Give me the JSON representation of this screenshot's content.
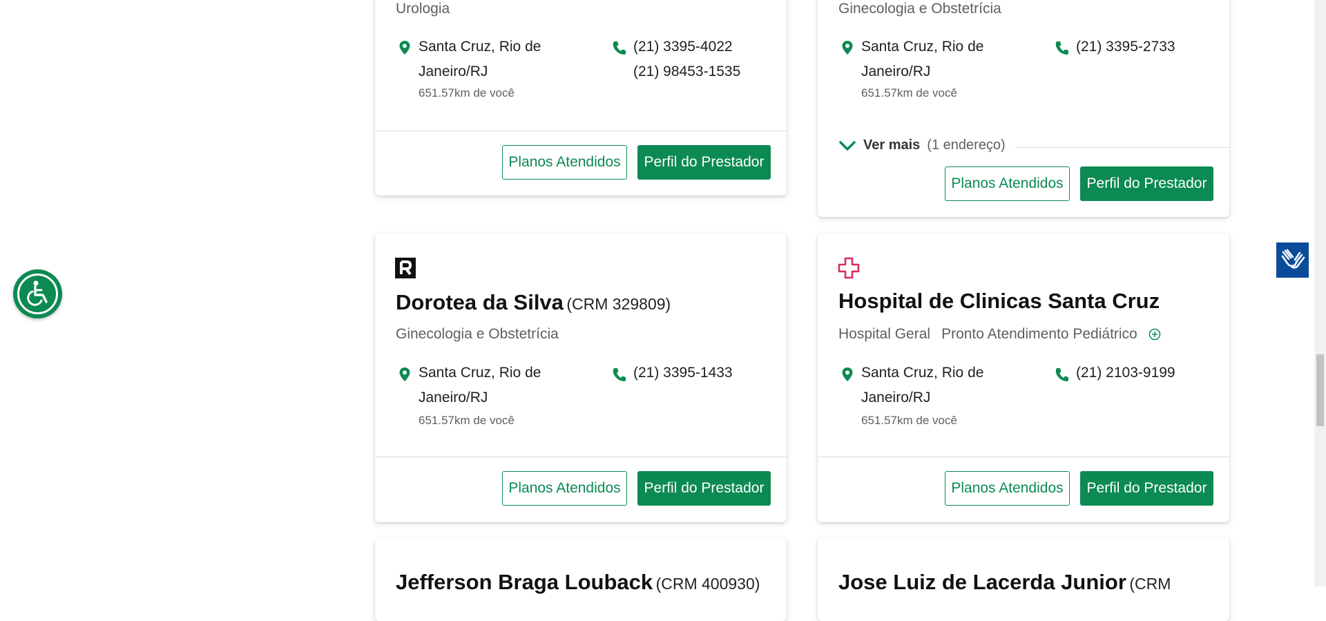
{
  "colors": {
    "brand_green": "#0b8a52",
    "accessibility_blue": "#0a4b9a",
    "cross_red": "#d72c5a"
  },
  "icons": {
    "location": "location-pin-icon",
    "phone": "phone-icon",
    "chevron": "chevron-down-icon",
    "plus": "plus-circle-icon",
    "accessibility": "wheelchair-accessibility-icon",
    "sign_language": "sign-language-hands-icon",
    "doctor_badge": "r-badge-icon",
    "hospital": "hospital-cross-icon"
  },
  "cards": {
    "urologia": {
      "specialty": "Urologia",
      "address_line1": "Santa Cruz, Rio de",
      "address_line2": "Janeiro/RJ",
      "distance": "651.57km de você",
      "phone1": "(21) 3395-4022",
      "phone2": "(21) 98453-1535",
      "plans_btn": "Planos Atendidos",
      "profile_btn": "Perfil do Prestador"
    },
    "gineco_top": {
      "specialty": "Ginecologia e Obstetrícia",
      "address_line1": "Santa Cruz, Rio de",
      "address_line2": "Janeiro/RJ",
      "distance": "651.57km de você",
      "phone1": "(21) 3395-2733",
      "ver_mais": "Ver mais",
      "ver_mais_count": "(1 endereço)",
      "plans_btn": "Planos Atendidos",
      "profile_btn": "Perfil do Prestador"
    },
    "dorotea": {
      "name": "Dorotea da Silva",
      "crm": "(CRM 329809)",
      "specialty": "Ginecologia e Obstetrícia",
      "address_line1": "Santa Cruz, Rio de",
      "address_line2": "Janeiro/RJ",
      "distance": "651.57km de você",
      "phone1": "(21) 3395-1433",
      "plans_btn": "Planos Atendidos",
      "profile_btn": "Perfil do Prestador"
    },
    "hospital": {
      "name": "Hospital de Clinicas Santa Cruz",
      "specialty1": "Hospital Geral",
      "specialty2": "Pronto Atendimento Pediátrico",
      "address_line1": "Santa Cruz, Rio de",
      "address_line2": "Janeiro/RJ",
      "distance": "651.57km de você",
      "phone1": "(21) 2103-9199",
      "plans_btn": "Planos Atendidos",
      "profile_btn": "Perfil do Prestador"
    },
    "jefferson": {
      "name": "Jefferson Braga Louback",
      "crm": "(CRM 400930)"
    },
    "jose": {
      "name": "Jose Luiz de Lacerda Junior",
      "crm": "(CRM"
    }
  }
}
